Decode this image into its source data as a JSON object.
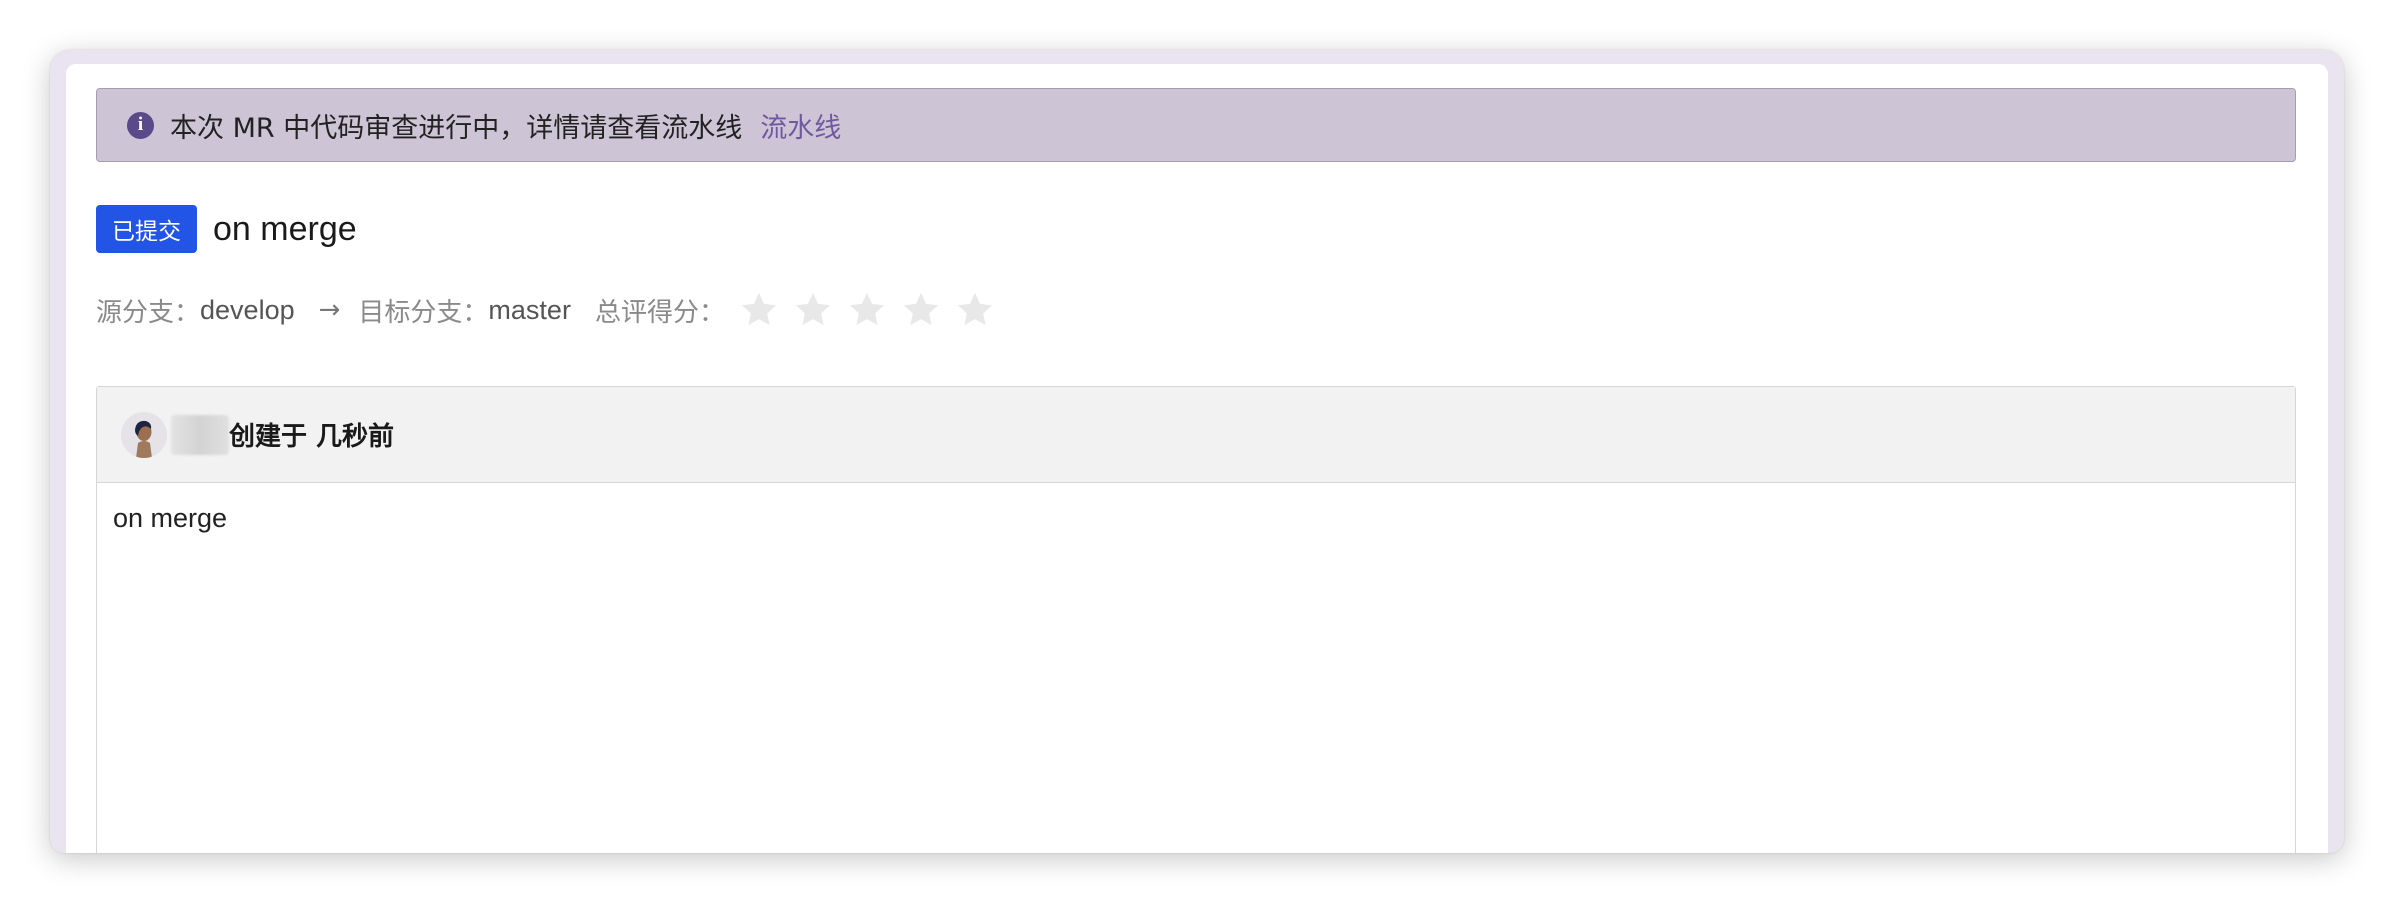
{
  "alert": {
    "icon": "info-icon",
    "icon_glyph": "i",
    "message": "本次 MR 中代码审查进行中，详情请查看流水线",
    "link_label": "流水线"
  },
  "merge_request": {
    "status": "已提交",
    "title": "on merge",
    "source_branch_label": "源分支：",
    "source_branch": "develop",
    "arrow": "→",
    "target_branch_label": "目标分支：",
    "target_branch": "master",
    "rating_label": "总评得分：",
    "rating": 0,
    "rating_max": 5
  },
  "comment": {
    "avatar": "avatar-icon",
    "created_text": "创建于 几秒前",
    "body": "on merge"
  },
  "colors": {
    "alert_bg": "#cdc4d6",
    "link": "#6f5aa0",
    "badge": "#2254e6",
    "star_empty": "#e8e8e8"
  }
}
